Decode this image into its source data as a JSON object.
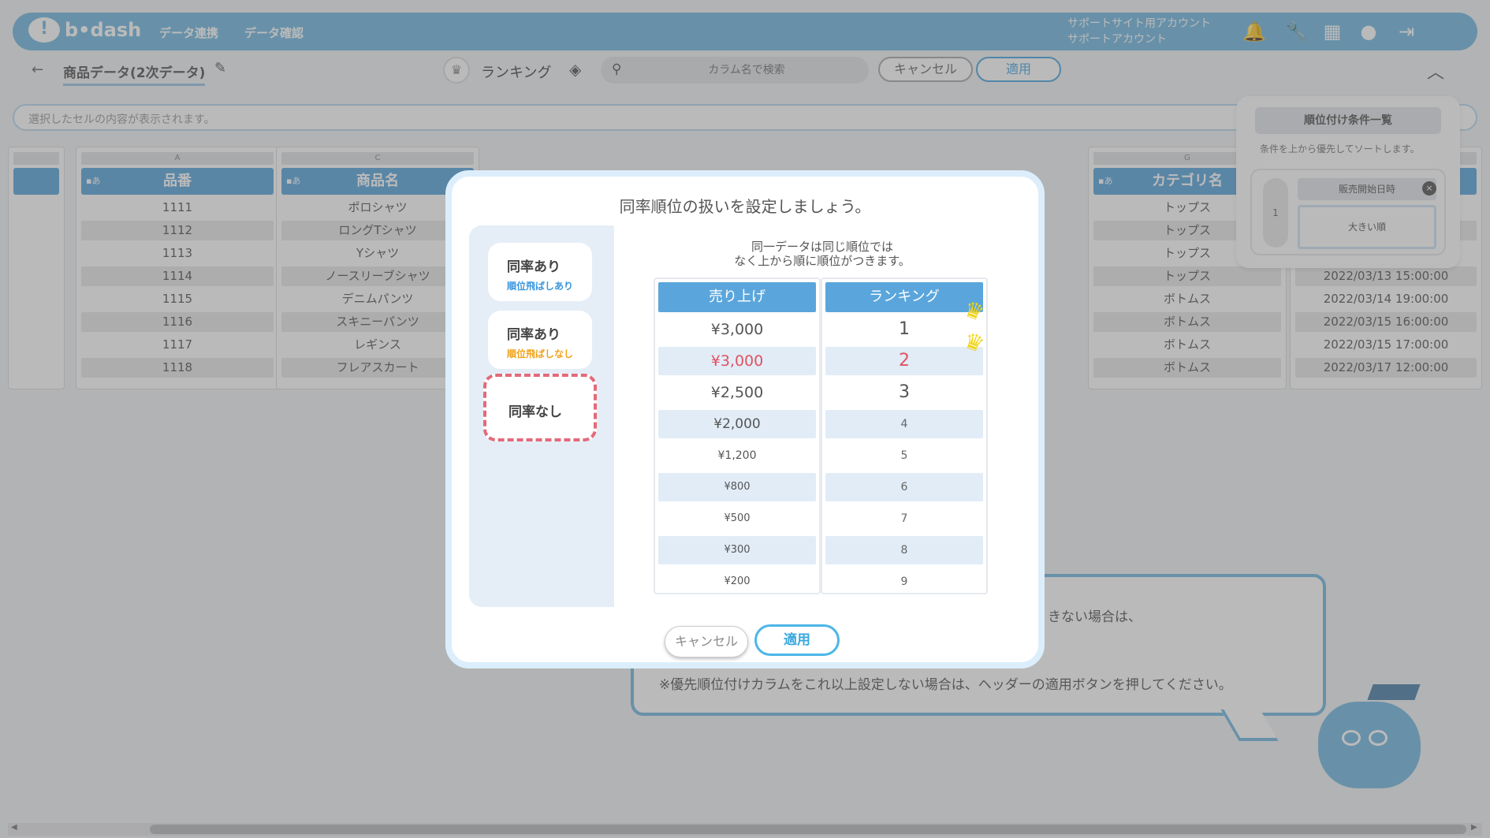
{
  "header": {
    "logo": "b•dash",
    "nav": [
      "データ連携",
      "データ確認"
    ],
    "account_line1": "サポートサイト用アカウント",
    "account_line2": "サポートアカウント",
    "icons": [
      "bell-icon",
      "wrench-icon",
      "grid-icon",
      "chat-icon",
      "logout-icon"
    ]
  },
  "subbar": {
    "dataset_name": "商品データ(2次データ)",
    "mode_label": "ランキング",
    "search_placeholder": "カラム名で検索",
    "cancel_label": "キャンセル",
    "apply_label": "適用"
  },
  "cell_content_placeholder": "選択したセルの内容が表示されます。",
  "grid": {
    "columns": [
      {
        "letter": "A",
        "type": "a",
        "name": "品番",
        "cells": [
          "1111",
          "1112",
          "1113",
          "1114",
          "1115",
          "1116",
          "1117",
          "1118"
        ]
      },
      {
        "letter": "C",
        "type": "a",
        "name": "商品名",
        "cells": [
          "ポロシャツ",
          "ロングTシャツ",
          "Yシャツ",
          "ノースリーブシャツ",
          "デニムパンツ",
          "スキニーパンツ",
          "レギンス",
          "フレアスカート"
        ]
      },
      {
        "letter": "G",
        "type": "a",
        "name": "カテゴリ名",
        "cells": [
          "トップス",
          "トップス",
          "トップス",
          "トップス",
          "ボトムス",
          "ボトムス",
          "ボトムス",
          "ボトムス"
        ]
      },
      {
        "letter": "",
        "type": "",
        "name": "",
        "cells": [
          "",
          "",
          "",
          "2022/03/13 15:00:00",
          "2022/03/14 19:00:00",
          "2022/03/15 16:00:00",
          "2022/03/15 17:00:00",
          "2022/03/17 12:00:00"
        ]
      }
    ]
  },
  "priority_panel": {
    "title": "順位付け条件一覧",
    "description": "条件を上から優先してソートします。",
    "number": "1",
    "column_name": "販売開始日時",
    "order": "大きい順"
  },
  "help": {
    "line1": "きない場合は、",
    "line2": "※優先順位付けカラムをこれ以上設定しない場合は、ヘッダーの適用ボタンを押してください。"
  },
  "modal": {
    "title": "同率順位の扱いを設定しましょう。",
    "options": [
      {
        "title": "同率あり",
        "subtitle": "順位飛ばしあり",
        "color": "#3a96dc"
      },
      {
        "title": "同率あり",
        "subtitle": "順位飛ばしなし",
        "color": "#f0a21a"
      },
      {
        "title": "同率なし",
        "subtitle": "",
        "color": ""
      }
    ],
    "description_line1": "同一データは同じ順位では",
    "description_line2": "なく上から順に順位がつきます。",
    "table": {
      "header_sales": "売り上げ",
      "header_rank": "ランキング",
      "sales": [
        "¥3,000",
        "¥3,000",
        "¥2,500",
        "¥2,000",
        "¥1,200",
        "¥800",
        "¥500",
        "¥300",
        "¥200"
      ],
      "ranks": [
        "1",
        "2",
        "3",
        "4",
        "5",
        "6",
        "7",
        "8",
        "9"
      ],
      "highlight_color": "#e2525f"
    },
    "cancel_label": "キャンセル",
    "apply_label": "適用"
  }
}
